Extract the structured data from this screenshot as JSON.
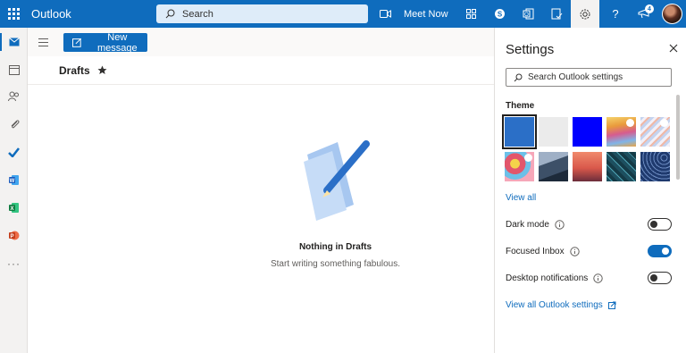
{
  "app": {
    "name": "Outlook",
    "accent_color": "#0f6cbd"
  },
  "topbar": {
    "search_placeholder": "Search",
    "meet_now_label": "Meet Now",
    "notification_count": "4",
    "icons": [
      "waffle-icon",
      "search-icon",
      "video-icon",
      "grid-icon",
      "skype-icon",
      "office-icon",
      "to-do-icon",
      "settings-icon",
      "help-icon",
      "feedback-icon"
    ]
  },
  "rail": {
    "items": [
      "mail-icon",
      "calendar-icon",
      "people-icon",
      "files-icon",
      "to-do-icon",
      "word-icon",
      "excel-icon",
      "powerpoint-icon",
      "more-icon"
    ]
  },
  "main": {
    "new_message_label": "New message",
    "folder_title": "Drafts",
    "empty_title": "Nothing in Drafts",
    "empty_subtitle": "Start writing something fabulous."
  },
  "settings": {
    "title": "Settings",
    "search_placeholder": "Search Outlook settings",
    "theme_label": "Theme",
    "themes": [
      {
        "name": "blue",
        "color": "#2b6fc7",
        "selected": true
      },
      {
        "name": "light-gray",
        "color": "#ebebeb",
        "selected": false
      },
      {
        "name": "bright-blue",
        "color": "#0000ff",
        "selected": false
      },
      {
        "name": "rainbow",
        "color": "#e9a54a",
        "selected": false
      },
      {
        "name": "pastel-lines",
        "color": "#9fb4d9",
        "selected": false
      },
      {
        "name": "illustration",
        "color": "#e88a9a",
        "selected": false
      },
      {
        "name": "mountain",
        "color": "#3d5068",
        "selected": false
      },
      {
        "name": "palm-sunset",
        "color": "#d9584b",
        "selected": false
      },
      {
        "name": "circuit",
        "color": "#1d4f5f",
        "selected": false
      },
      {
        "name": "navy-lines",
        "color": "#1f3a6e",
        "selected": false
      }
    ],
    "view_all_label": "View all",
    "toggles": [
      {
        "label": "Dark mode",
        "on": false
      },
      {
        "label": "Focused Inbox",
        "on": true
      },
      {
        "label": "Desktop notifications",
        "on": false
      }
    ],
    "view_all_settings_label": "View all Outlook settings"
  }
}
